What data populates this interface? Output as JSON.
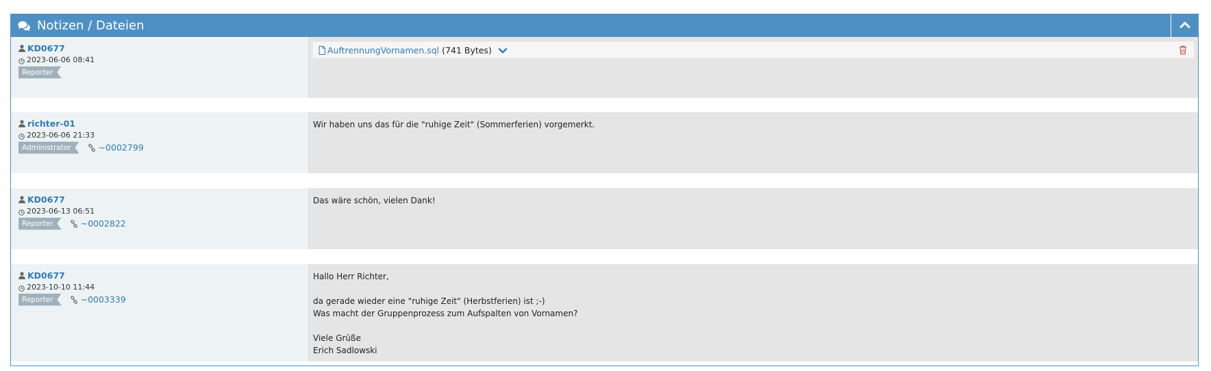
{
  "widget": {
    "title": "Notizen / Dateien",
    "header_icon": "comments-icon",
    "collapse_icon": "chevron-up-icon",
    "header_color": "#4f90c4"
  },
  "notes": [
    {
      "author": "KD0677",
      "date": "2023-06-06 08:41",
      "role": "Reporter",
      "attachment": {
        "file_name": "AuftrennungVornamen.sql",
        "size": "(741 Bytes)"
      }
    },
    {
      "author": "richter-01",
      "date": "2023-06-06 21:33",
      "role": "Administrator",
      "link": "~0002799",
      "lines": [
        "Wir haben uns das für die \"ruhige Zeit\" (Sommerferien) vorgemerkt."
      ]
    },
    {
      "author": "KD0677",
      "date": "2023-06-13 06:51",
      "role": "Reporter",
      "link": "~0002822",
      "lines": [
        "Das wäre schön, vielen Dank!"
      ]
    },
    {
      "author": "KD0677",
      "date": "2023-10-10 11:44",
      "role": "Reporter",
      "link": "~0003339",
      "lines": [
        "Hallo Herr Richter,",
        "",
        "da gerade wieder eine \"ruhige Zeit\" (Herbstferien) ist ;-)",
        "Was macht der Gruppenprozess zum Aufspalten von Vornamen?",
        "",
        "Viele Grüße",
        "Erich Sadlowski"
      ]
    }
  ]
}
